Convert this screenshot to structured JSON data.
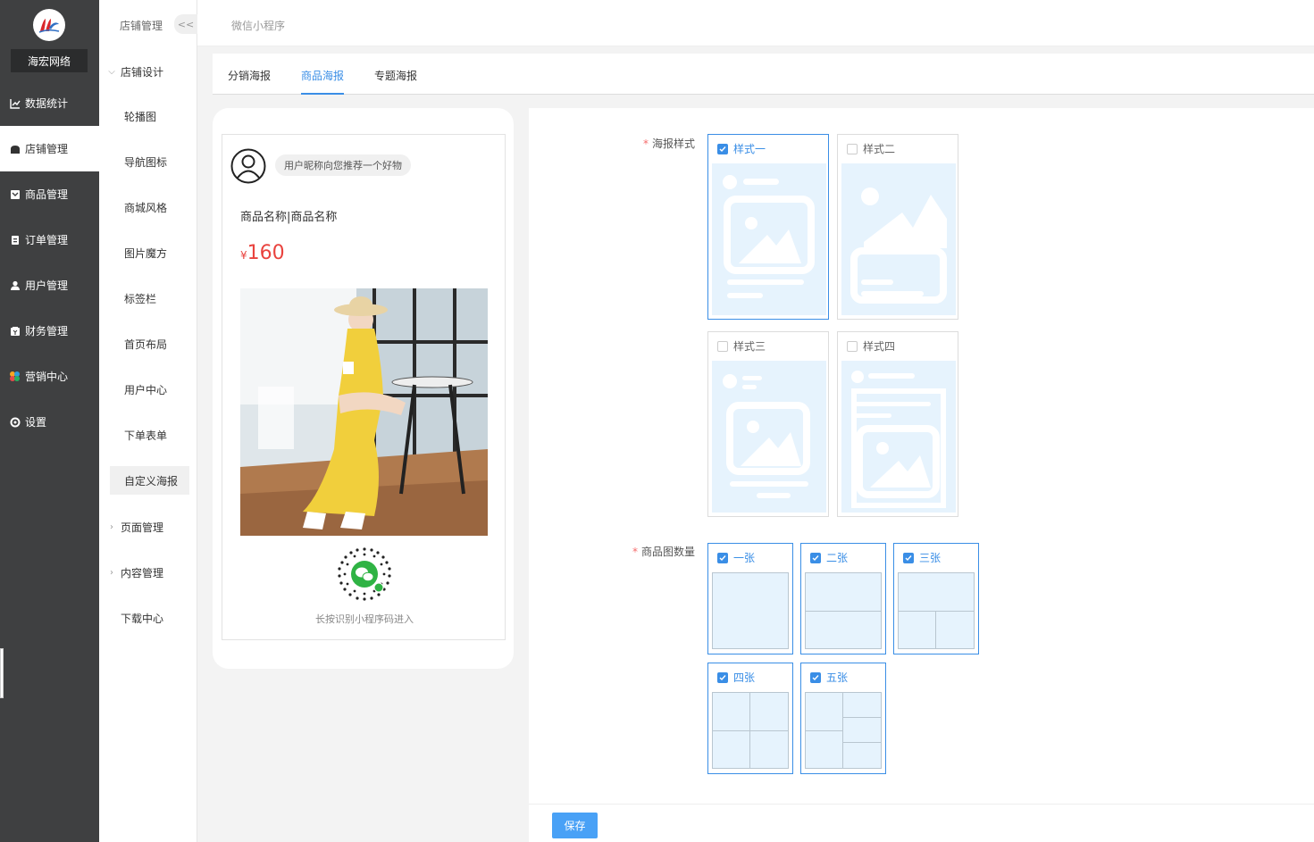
{
  "brand": {
    "name": "海宏网络"
  },
  "nav": {
    "items": [
      {
        "label": "数据统计",
        "icon": "chart-line-icon"
      },
      {
        "label": "店铺管理",
        "icon": "store-icon"
      },
      {
        "label": "商品管理",
        "icon": "goods-icon"
      },
      {
        "label": "订单管理",
        "icon": "order-icon"
      },
      {
        "label": "用户管理",
        "icon": "user-icon"
      },
      {
        "label": "财务管理",
        "icon": "finance-icon"
      },
      {
        "label": "营销中心",
        "icon": "marketing-icon"
      },
      {
        "label": "设置",
        "icon": "settings-icon"
      }
    ],
    "active": "店铺管理"
  },
  "submenu": {
    "title": "店铺管理",
    "collapse_label": "<<",
    "group_design": "店铺设计",
    "items": [
      "轮播图",
      "导航图标",
      "商城风格",
      "图片魔方",
      "标签栏",
      "首页布局",
      "用户中心",
      "下单表单",
      "自定义海报"
    ],
    "active": "自定义海报",
    "group_page": "页面管理",
    "group_content": "内容管理",
    "download": "下载中心"
  },
  "topbar": {
    "crumb": "微信小程序"
  },
  "tabs": {
    "items": [
      "分销海报",
      "商品海报",
      "专题海报"
    ],
    "active": "商品海报"
  },
  "preview": {
    "nickname_text": "用户昵称向您推荐一个好物",
    "goods_name": "商品名称|商品名称",
    "currency": "¥",
    "price": "160",
    "qr_tip": "长按识别小程序码进入"
  },
  "form": {
    "style_label": "海报样式",
    "styles": [
      {
        "label": "样式一",
        "checked": true
      },
      {
        "label": "样式二",
        "checked": false
      },
      {
        "label": "样式三",
        "checked": false
      },
      {
        "label": "样式四",
        "checked": false
      }
    ],
    "count_label": "商品图数量",
    "counts": [
      {
        "label": "一张",
        "checked": true
      },
      {
        "label": "二张",
        "checked": true
      },
      {
        "label": "三张",
        "checked": true
      },
      {
        "label": "四张",
        "checked": true
      },
      {
        "label": "五张",
        "checked": true
      }
    ]
  },
  "footer": {
    "save_label": "保存"
  },
  "colors": {
    "accent": "#3a8ee6",
    "nav_bg": "#3f4041",
    "price": "#e9433e",
    "placeholder_bg": "#e6f3fd",
    "placeholder_fg": "#ffffff"
  }
}
